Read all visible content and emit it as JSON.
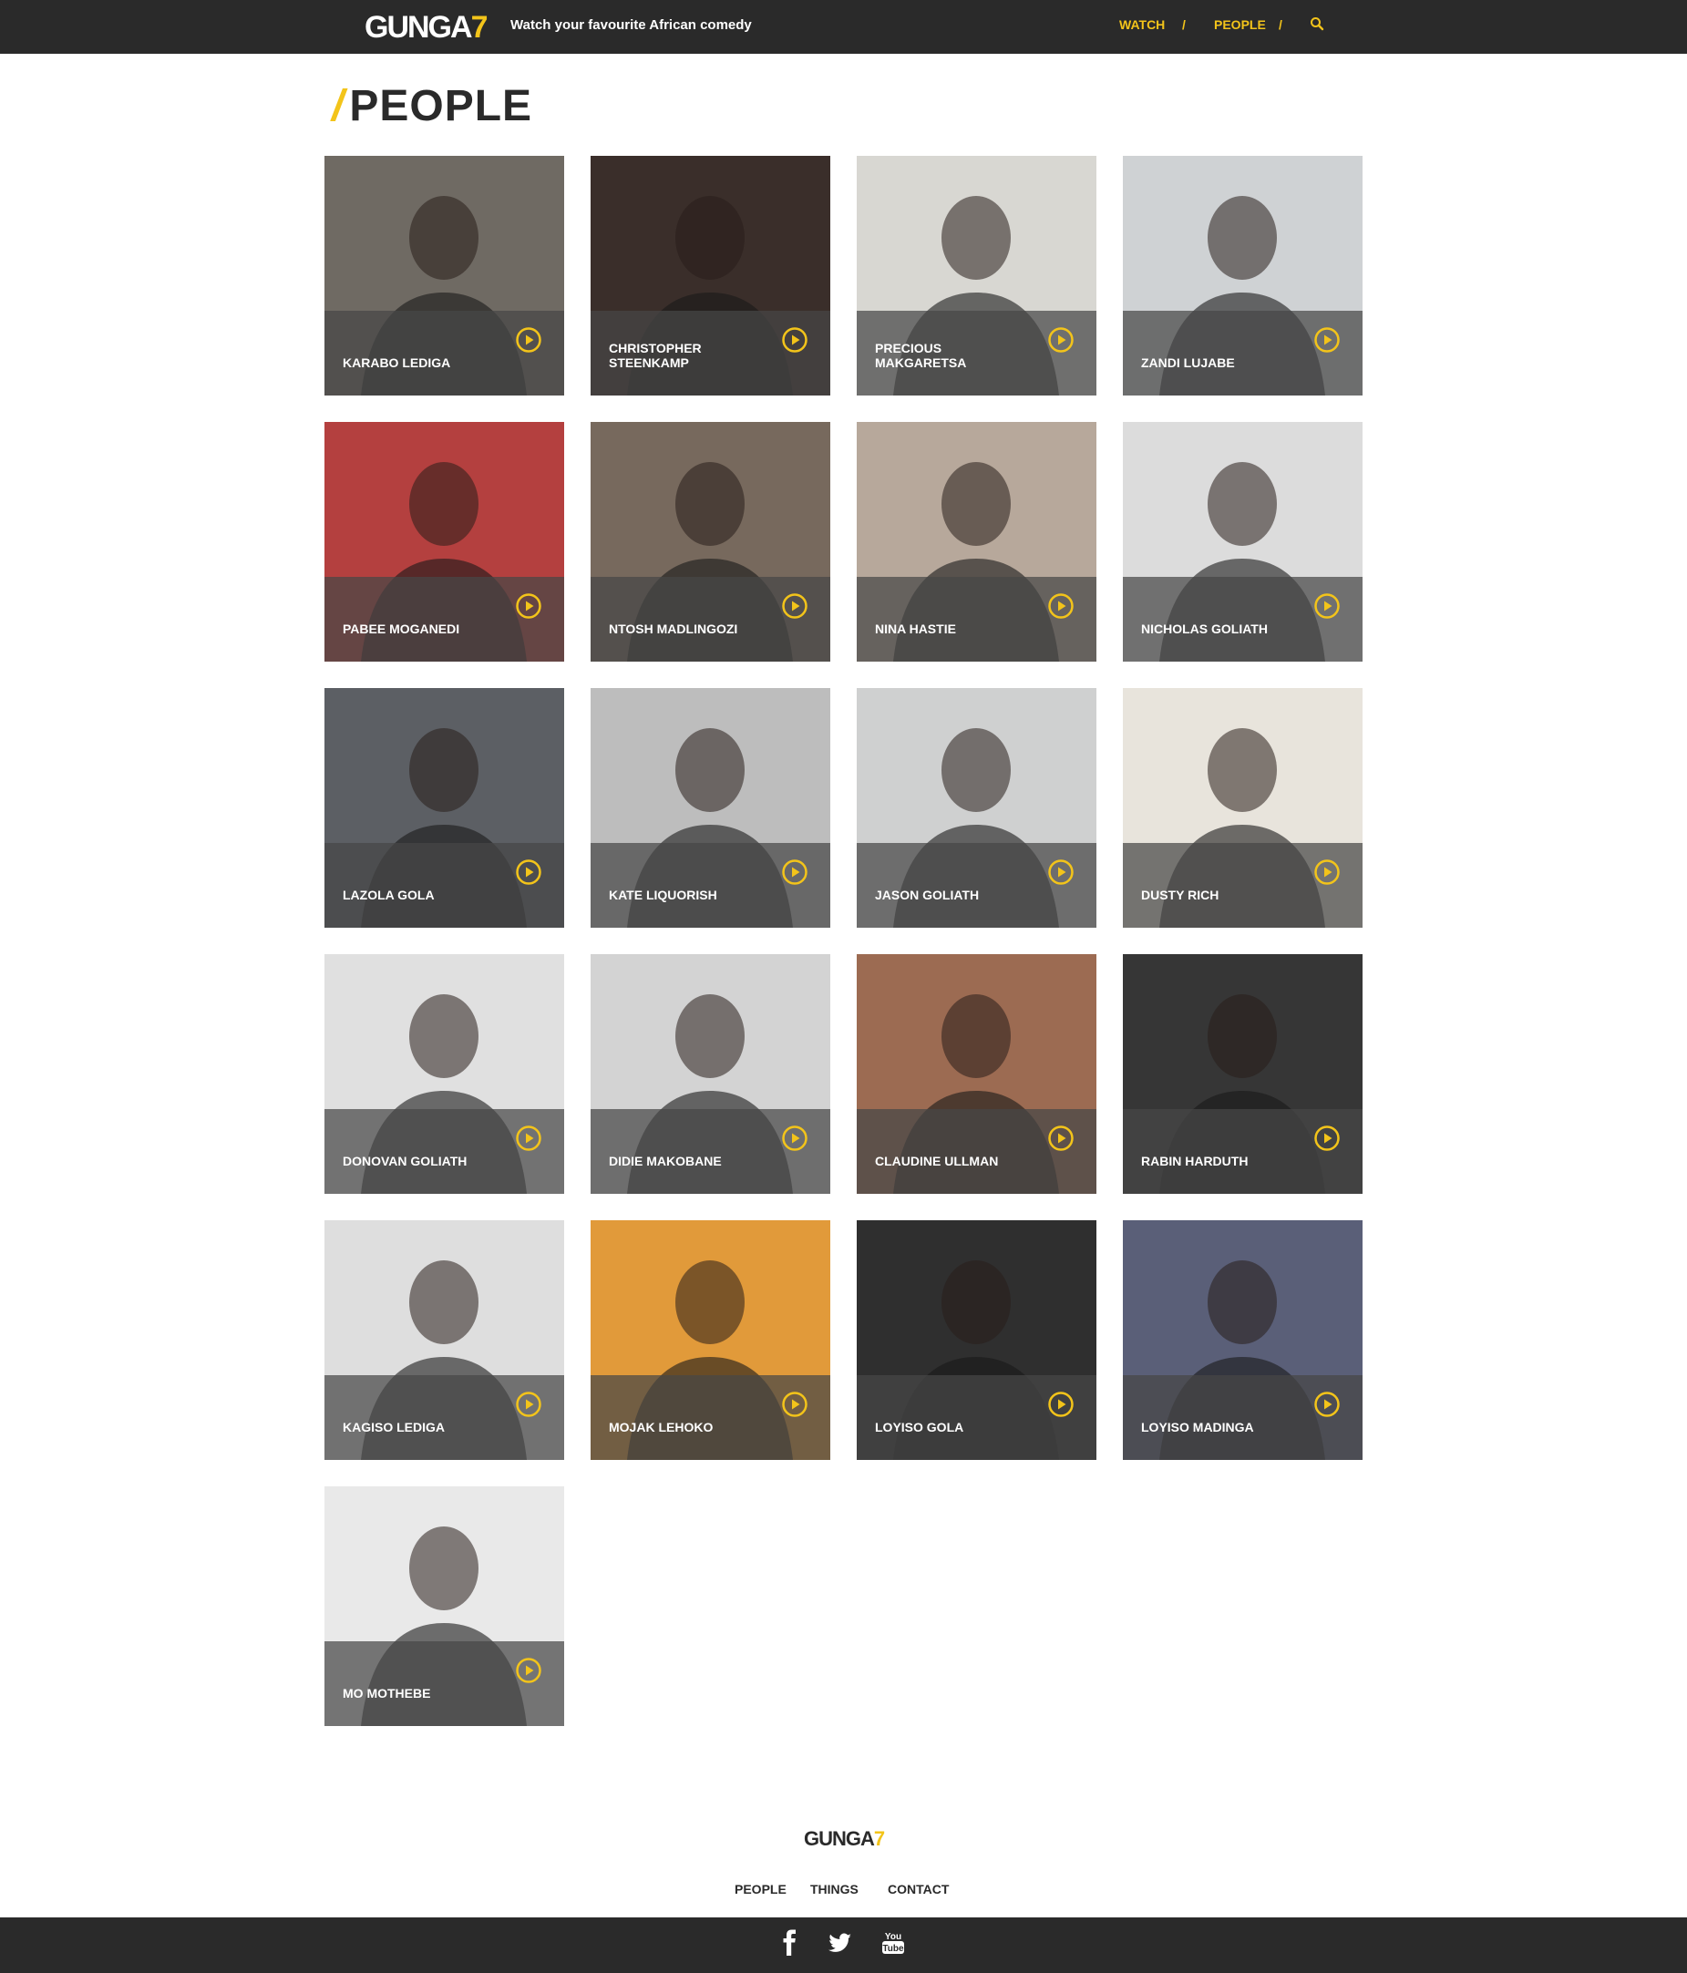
{
  "header": {
    "logo_word": "GUNGA",
    "logo_seven": "7",
    "tagline": "Watch your favourite African comedy",
    "nav": {
      "watch": "WATCH",
      "people": "PEOPLE",
      "sep": "/"
    },
    "search_icon": "search-icon"
  },
  "page": {
    "title_slash": "/",
    "title": "PEOPLE"
  },
  "people": [
    {
      "name": "KARABO LEDIGA",
      "bg": "#6f6a63"
    },
    {
      "name": "CHRISTOPHER STEENKAMP",
      "bg": "#3a2e2a"
    },
    {
      "name": "PRECIOUS MAKGARETSA",
      "bg": "#d8d7d2"
    },
    {
      "name": "ZANDI LUJABE",
      "bg": "#cfd2d4"
    },
    {
      "name": "PABEE MOGANEDI",
      "bg": "#b4403f"
    },
    {
      "name": "NTOSH MADLINGOZI",
      "bg": "#77695d"
    },
    {
      "name": "NINA HASTIE",
      "bg": "#b7a89b"
    },
    {
      "name": "NICHOLAS GOLIATH",
      "bg": "#dcdcdc"
    },
    {
      "name": "LAZOLA GOLA",
      "bg": "#5c5f64"
    },
    {
      "name": "KATE LIQUORISH",
      "bg": "#bdbdbd"
    },
    {
      "name": "JASON GOLIATH",
      "bg": "#cfd0d0"
    },
    {
      "name": "DUSTY RICH",
      "bg": "#e8e4dc"
    },
    {
      "name": "DONOVAN GOLIATH",
      "bg": "#e0e0e0"
    },
    {
      "name": "DIDIE MAKOBANE",
      "bg": "#d3d3d3"
    },
    {
      "name": "CLAUDINE ULLMAN",
      "bg": "#9c6b52"
    },
    {
      "name": "RABIN HARDUTH",
      "bg": "#363636"
    },
    {
      "name": "KAGISO LEDIGA",
      "bg": "#dedede"
    },
    {
      "name": "MOJAK LEHOKO",
      "bg": "#e19a3a"
    },
    {
      "name": "LOYISO GOLA",
      "bg": "#2f2f2f"
    },
    {
      "name": "LOYISO MADINGA",
      "bg": "#5a5f78"
    },
    {
      "name": "MO MOTHEBE",
      "bg": "#e9e9e9"
    }
  ],
  "footer": {
    "logo_word": "GUNGA",
    "logo_seven": "7",
    "nav": [
      "PEOPLE",
      "THINGS",
      "CONTACT"
    ],
    "social": [
      "facebook-icon",
      "twitter-icon",
      "youtube-icon"
    ]
  },
  "colors": {
    "accent": "#f3c41a",
    "dark": "#2a2a2a"
  }
}
